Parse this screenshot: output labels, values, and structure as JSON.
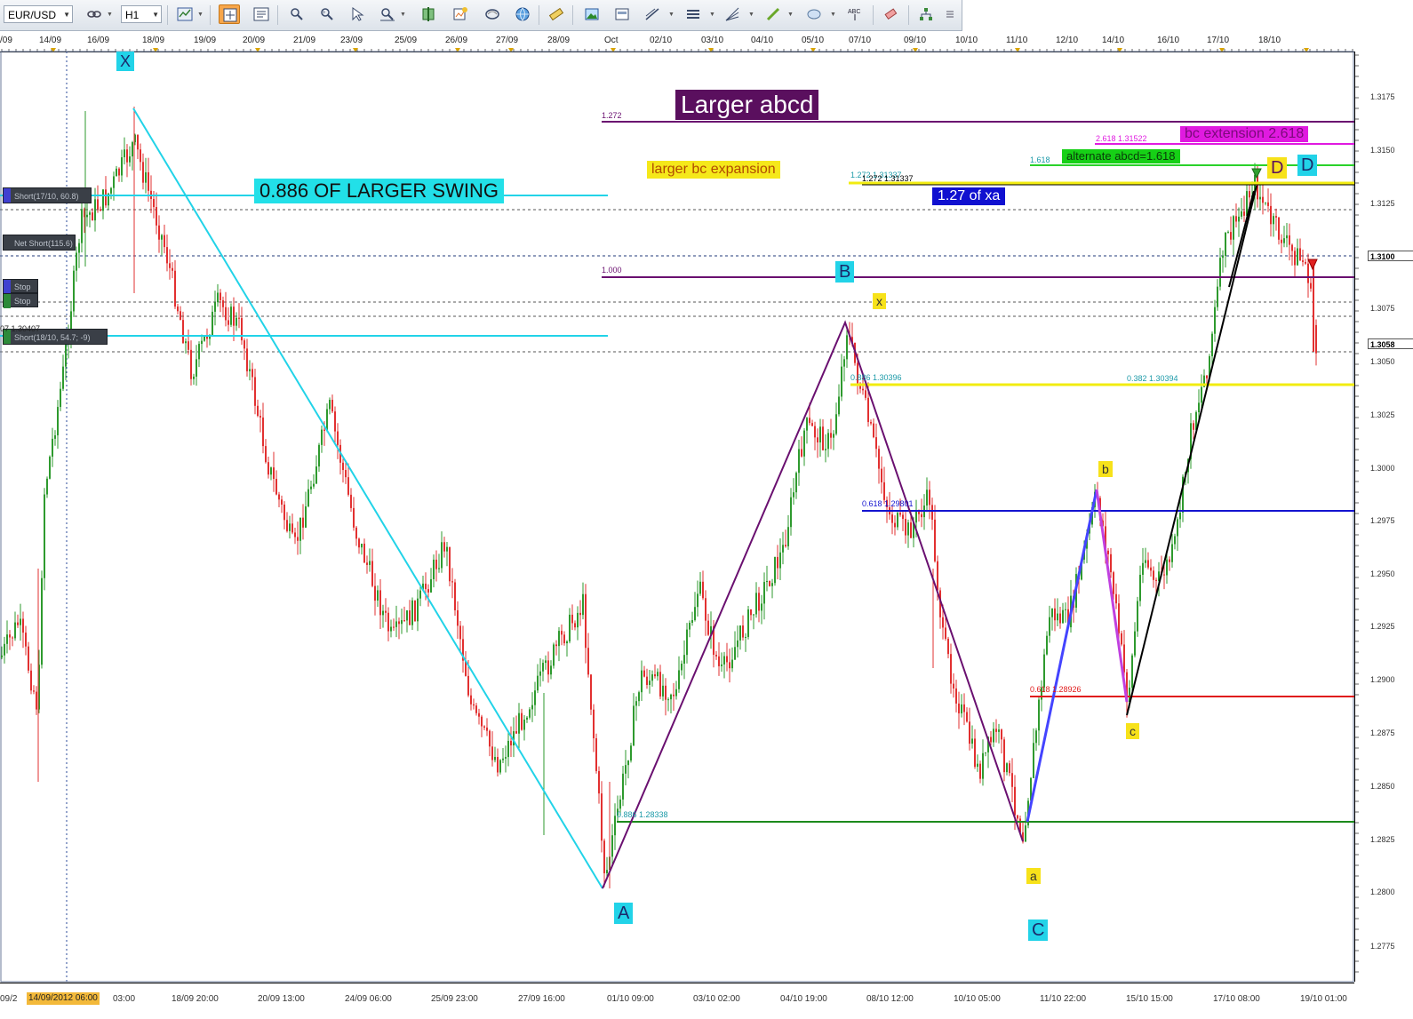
{
  "toolbar": {
    "symbol": "EUR/USD",
    "timeframe": "H1",
    "buttons": [
      "chart-type-icon",
      "crosshair-icon",
      "properties-icon",
      "indicators-icon",
      "magnet-icon",
      "zoom-icon",
      "zoom-range-icon",
      "snapshot-icon",
      "template-icon",
      "globe-icon",
      "ruler-icon",
      "picture-icon",
      "object-list-icon",
      "trend-tools-icon",
      "horizontal-lines-icon",
      "fibonacci-icon",
      "pen-icon",
      "ellipse-icon",
      "text-abc-icon",
      "eraser-icon",
      "hierarchy-icon",
      "more-icon"
    ]
  },
  "top_axis": {
    "labels": [
      "/09",
      "14/09",
      "16/09",
      "18/09",
      "19/09",
      "20/09",
      "21/09",
      "23/09",
      "25/09",
      "26/09",
      "27/09",
      "28/09",
      "Oct",
      "02/10",
      "03/10",
      "04/10",
      "05/10",
      "07/10",
      "09/10",
      "10/10",
      "11/10",
      "12/10",
      "14/10",
      "16/10",
      "17/10",
      "18/10"
    ]
  },
  "bottom_axis": {
    "badge": "14/09/2012 06:00",
    "labels": [
      "09/2",
      "03:00",
      "18/09 20:00",
      "20/09 13:00",
      "24/09 06:00",
      "25/09 23:00",
      "27/09 16:00",
      "01/10 09:00",
      "03/10 02:00",
      "04/10 19:00",
      "08/10 12:00",
      "10/10 05:00",
      "11/10 22:00",
      "15/10 15:00",
      "17/10 08:00",
      "19/10 01:00"
    ]
  },
  "price_axis": {
    "labels": [
      "1.3175",
      "1.3150",
      "1.3125",
      "1.3075",
      "1.3050",
      "1.3025",
      "1.3000",
      "1.2975",
      "1.2950",
      "1.2925",
      "1.2900",
      "1.2875",
      "1.2850",
      "1.2825",
      "1.2800",
      "1.2775"
    ],
    "current_price": "1.3100",
    "last_price": "1.3058"
  },
  "positions": [
    {
      "label": "Short(17/10, 60.8)",
      "color": "#4040d0"
    },
    {
      "label": "Net Short(115.6)",
      "color": "#3a3f47"
    },
    {
      "label": "Stop",
      "color": "#4040d0"
    },
    {
      "label": "Stop",
      "color": "#2d8a3a"
    },
    {
      "label": "Short(18/10, 54.7; -9)",
      "color": "#2d8a3a"
    }
  ],
  "left_price_text": "07 1.30407",
  "annotations": {
    "larger_abcd": "Larger abcd",
    "swing_886": "0.886 OF LARGER SWING",
    "larger_bc": "larger bc expansion",
    "bc_ext": "bc extension 2.618",
    "alt_abcd": "alternate abcd=1.618",
    "xa_127": "1.27 of xa"
  },
  "wave_labels": {
    "X": "X",
    "A": "A",
    "B": "B",
    "C": "C",
    "D_cyan": "D",
    "D_yellow": "D",
    "x_small": "x",
    "a": "a",
    "b": "b",
    "c": "c"
  },
  "fib_labels": {
    "f1272": "1.272",
    "f1000": "1.000",
    "f2618": "2.618  1.31522",
    "f1618": "1.618",
    "f1272b": "1.272  1.31337",
    "f1272c": "1.272  1.31337",
    "f886a": "0.886  1.30396",
    "f382": "0.382  1.30394",
    "f618a": "0.618  1.29801",
    "f618b": "0.618  1.28926",
    "f886b": "0.886  1.28338"
  },
  "colors": {
    "bull": "#2e9a2e",
    "bear": "#e23030",
    "cyan": "#22d3e8",
    "purple": "#6a1070",
    "yellow": "#f2ec10",
    "blue": "#1414d0",
    "red": "#e01a1a",
    "green": "#1c8a1c",
    "magenta": "#e01ae0",
    "black": "#000000"
  }
}
